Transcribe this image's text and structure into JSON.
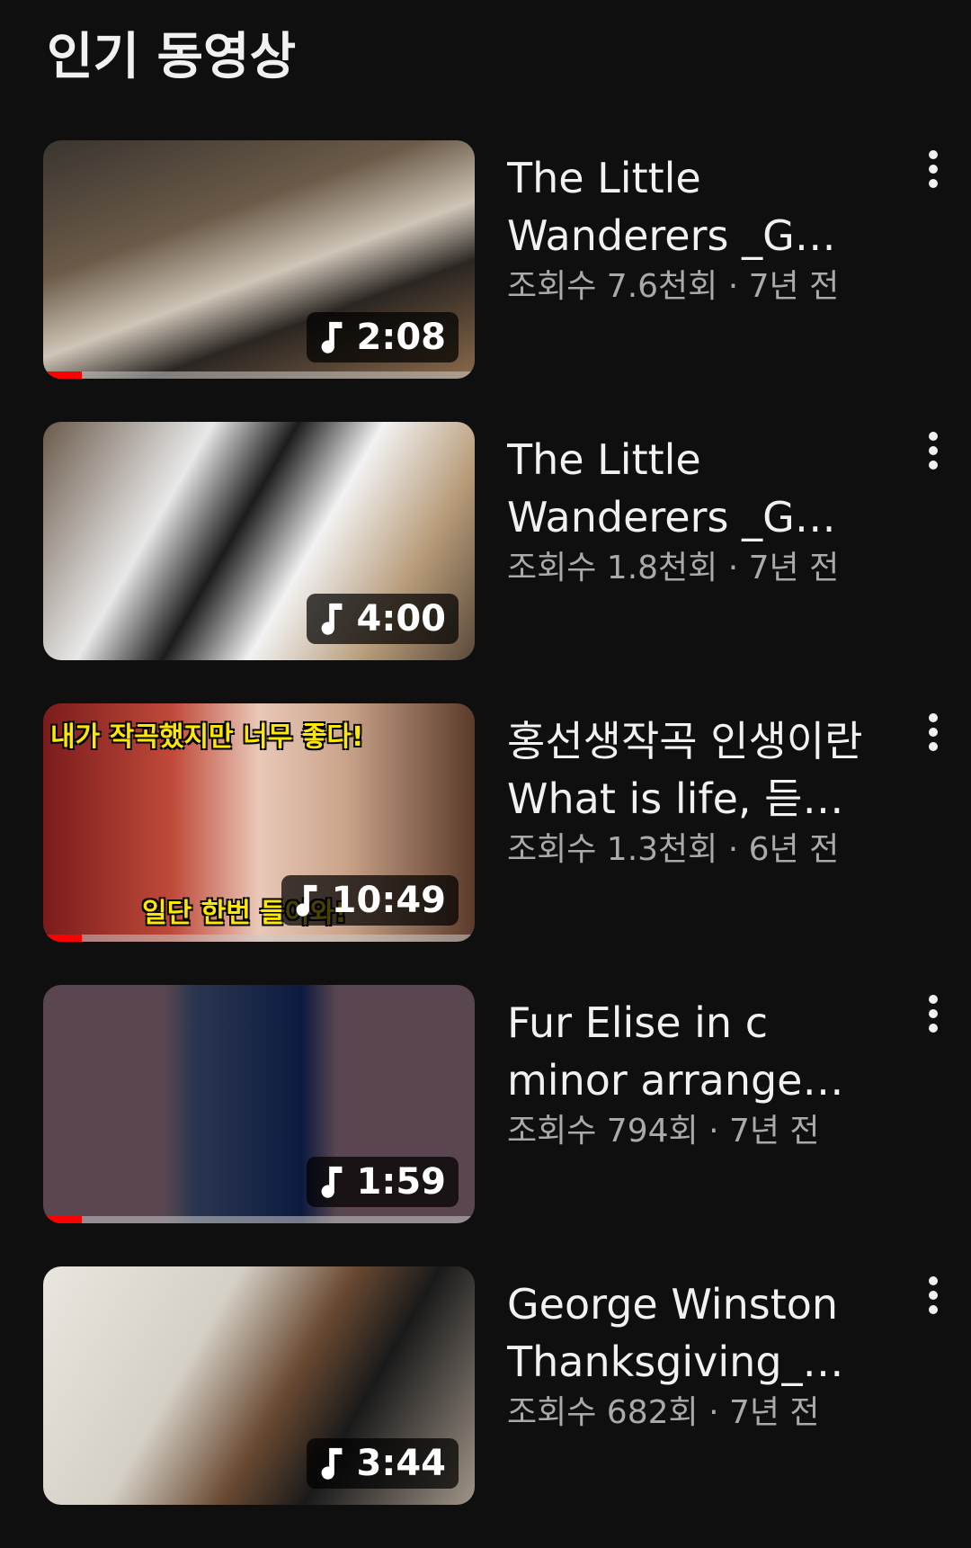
{
  "section": {
    "title": "인기 동영상"
  },
  "videos": [
    {
      "title": "The Little Wanderers _G…",
      "meta": "조회수 7.6천회 · 7년 전",
      "duration": "2:08",
      "watched_fraction": 0.09
    },
    {
      "title": "The Little Wanderers _G…",
      "meta": "조회수 1.8천회 · 7년 전",
      "duration": "4:00",
      "watched_fraction": 0
    },
    {
      "title": "홍선생작곡 인생이란 What is life, 듣…",
      "meta": "조회수 1.3천회 · 6년 전",
      "duration": "10:49",
      "watched_fraction": 0.09,
      "thumbnail_text_top": "내가 작곡했지만 너무 좋다!",
      "thumbnail_text_bottom": "일단 한번 들어와!"
    },
    {
      "title": "Fur Elise in c minor arrange…",
      "meta": "조회수 794회 · 7년 전",
      "duration": "1:59",
      "watched_fraction": 0.09
    },
    {
      "title": "George Winston Thanksgiving_…",
      "meta": "조회수 682회 · 7년 전",
      "duration": "3:44",
      "watched_fraction": 0
    }
  ],
  "icons": {
    "duration": "music-note-icon",
    "menu": "more-vert-icon"
  },
  "colors": {
    "background": "#0f0f0f",
    "progress": "#ff0000",
    "title": "#f1f1f1",
    "meta": "#aaaaaa"
  }
}
